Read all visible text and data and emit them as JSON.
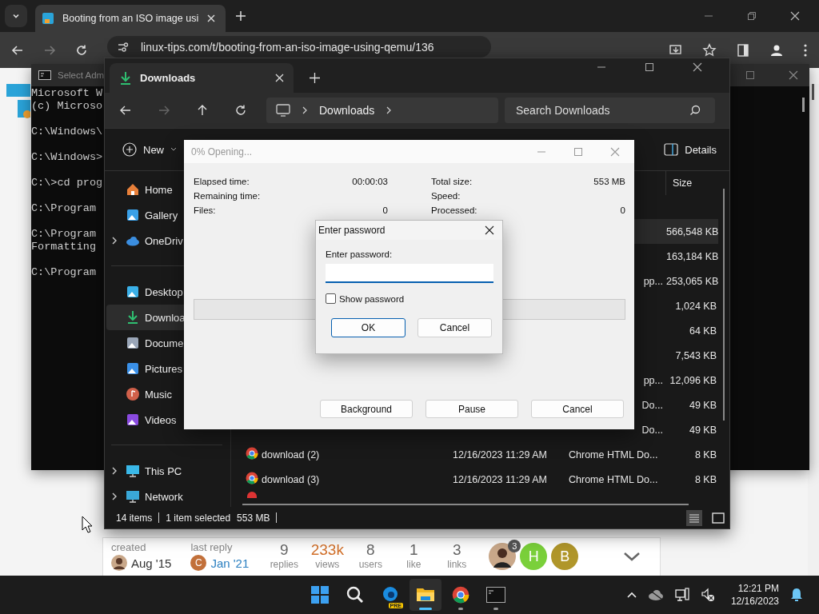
{
  "browser": {
    "tab": {
      "title": "Booting from an ISO image usi",
      "selected": true
    },
    "address": "linux-tips.com/t/booting-from-an-iso-image-using-qemu/136",
    "footer": {
      "created_label": "created",
      "created": "Aug '15",
      "last_reply_label": "last reply",
      "last_reply_avatar": "C",
      "last_reply": "Jan '21",
      "stats": [
        {
          "value": "9",
          "label": "replies",
          "highlight": false
        },
        {
          "value": "233k",
          "label": "views",
          "highlight": true
        },
        {
          "value": "8",
          "label": "users",
          "highlight": false
        },
        {
          "value": "1",
          "label": "like",
          "highlight": false
        },
        {
          "value": "3",
          "label": "links",
          "highlight": false
        }
      ],
      "participants": [
        {
          "kind": "photo",
          "badge": "3"
        },
        {
          "kind": "letter",
          "letter": "H",
          "color": "#7ad03a"
        },
        {
          "kind": "letter",
          "letter": "B",
          "color": "#b0962a"
        }
      ]
    }
  },
  "console": {
    "title": "Select Adm",
    "blocks": [
      [
        "Microsoft W",
        "(c) Microso"
      ],
      [
        "C:\\Windows\\"
      ],
      [
        "C:\\Windows>"
      ],
      [
        "C:\\>cd prog"
      ],
      [
        "C:\\Program"
      ],
      [
        "C:\\Program",
        "Formatting"
      ],
      [
        "C:\\Program"
      ]
    ]
  },
  "explorer": {
    "tab": "Downloads",
    "breadcrumb": "Downloads",
    "search": {
      "placeholder": "Search Downloads"
    },
    "new_button": "New",
    "details_button": "Details",
    "size_column": "Size",
    "sidebar": [
      [
        {
          "label": "Home",
          "kind": "home",
          "expandable": false,
          "selected": false
        },
        {
          "label": "Gallery",
          "kind": "gallery",
          "expandable": false,
          "selected": false
        },
        {
          "label": "OneDriv",
          "kind": "cloud",
          "expandable": true,
          "selected": false
        }
      ],
      [
        {
          "label": "Desktop",
          "kind": "desktop",
          "expandable": false,
          "selected": false
        },
        {
          "label": "Downloa",
          "kind": "download",
          "expandable": false,
          "selected": true
        },
        {
          "label": "Docume",
          "kind": "document",
          "expandable": false,
          "selected": false
        },
        {
          "label": "Pictures",
          "kind": "pictures",
          "expandable": false,
          "selected": false
        },
        {
          "label": "Music",
          "kind": "music",
          "expandable": false,
          "selected": false
        },
        {
          "label": "Videos",
          "kind": "videos",
          "expandable": false,
          "selected": false
        }
      ],
      [
        {
          "label": "This PC",
          "kind": "pc",
          "expandable": true,
          "selected": false
        },
        {
          "label": "Network",
          "kind": "network",
          "expandable": true,
          "selected": false
        }
      ]
    ],
    "rows": [
      {
        "size": "566,548 KB",
        "selected": true
      },
      {
        "size": "163,184 KB",
        "selected": false
      },
      {
        "type_end": "pp...",
        "size": "253,065 KB",
        "selected": false
      },
      {
        "size": "1,024 KB",
        "selected": false
      },
      {
        "size": "64 KB",
        "selected": false
      },
      {
        "size": "7,543 KB",
        "selected": false
      },
      {
        "type_end": "pp...",
        "size": "12,096 KB",
        "selected": false
      },
      {
        "type_end": "Do...",
        "size": "49 KB",
        "selected": false
      },
      {
        "type_end": "Do...",
        "size": "49 KB",
        "selected": false
      },
      {
        "kind": "chrome",
        "name": "download (2)",
        "date": "12/16/2023 11:29 AM",
        "type": "Chrome HTML Do...",
        "size": "8 KB",
        "selected": false
      },
      {
        "kind": "chrome",
        "name": "download (3)",
        "date": "12/16/2023 11:29 AM",
        "type": "Chrome HTML Do...",
        "size": "8 KB",
        "selected": false
      }
    ],
    "status": {
      "count": "14 items",
      "selection": "1 item selected",
      "size": "553 MB"
    }
  },
  "progress_dialog": {
    "title": "0% Opening...",
    "left": [
      {
        "label": "Elapsed time:",
        "value": "00:00:03"
      },
      {
        "label": "Remaining time:"
      },
      {
        "label": "Files:",
        "value": "0"
      }
    ],
    "right": [
      {
        "label": "Total size:",
        "value": "553 MB"
      },
      {
        "label": "Speed:"
      },
      {
        "label": "Processed:",
        "value": "0"
      }
    ],
    "level": 0,
    "buttons": [
      "Background",
      "Pause",
      "Cancel"
    ]
  },
  "password_dialog": {
    "title": "Enter password",
    "label": "Enter password:",
    "show_password": {
      "label": "Show password",
      "checked": false
    },
    "ok": "OK",
    "cancel": "Cancel"
  },
  "taskbar": {
    "apps": [
      {
        "kind": "start",
        "running": false,
        "active": false
      },
      {
        "kind": "search",
        "running": false,
        "active": false
      },
      {
        "kind": "edge",
        "badge": "PRE",
        "running": false,
        "active": false
      },
      {
        "kind": "explorer",
        "running": true,
        "active": true
      },
      {
        "kind": "chrome",
        "running": true,
        "active": false
      },
      {
        "kind": "terminal",
        "running": true,
        "active": false
      }
    ],
    "time": "12:21 PM",
    "date": "12/16/2023"
  }
}
